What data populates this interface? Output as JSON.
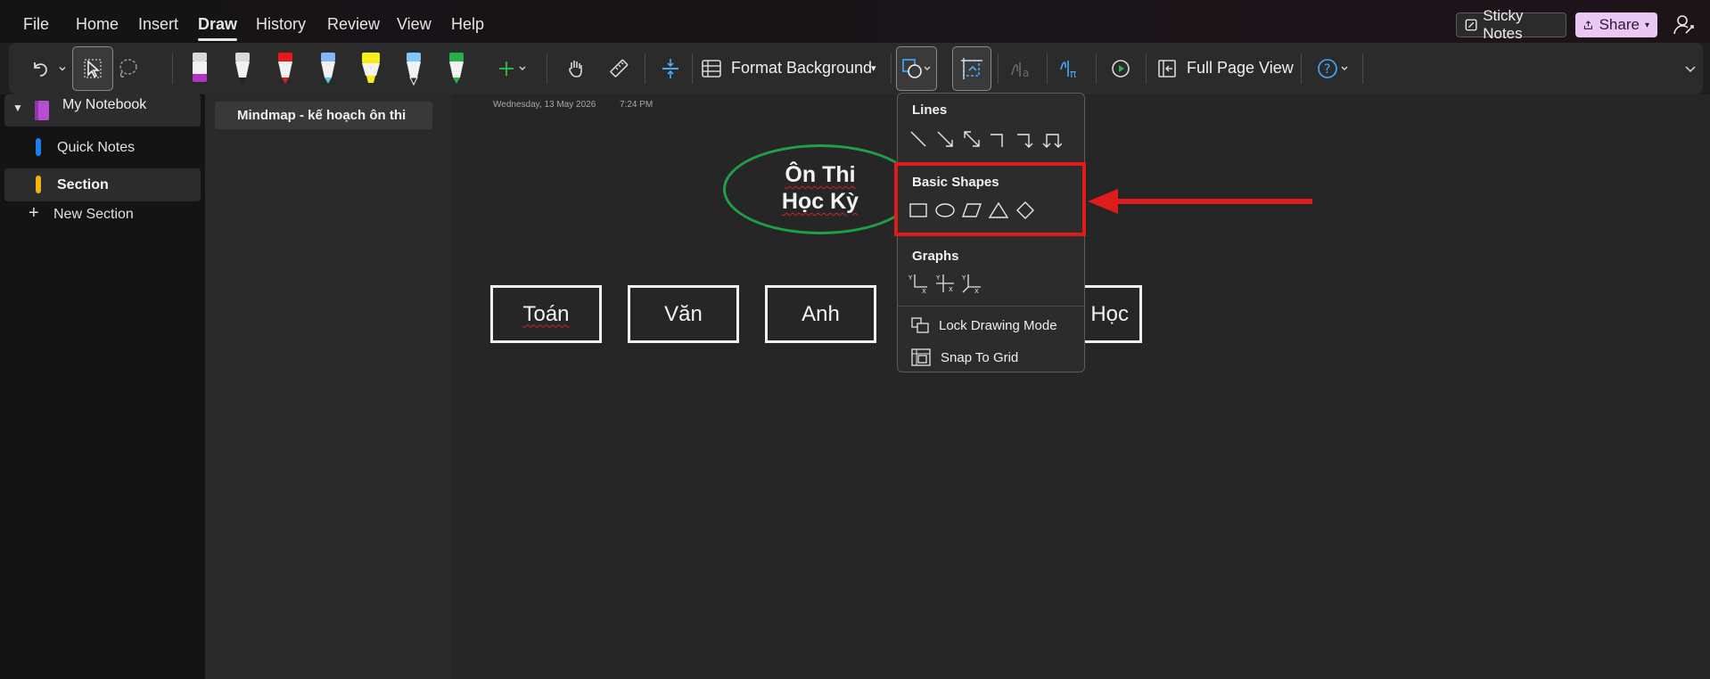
{
  "menu": {
    "items": [
      "File",
      "Home",
      "Insert",
      "Draw",
      "History",
      "Review",
      "View",
      "Help"
    ],
    "active": "Draw",
    "sticky_notes": "Sticky Notes",
    "share": "Share"
  },
  "ribbon": {
    "format_background": "Format Background",
    "full_page_view": "Full Page View"
  },
  "nav": {
    "notebook": "My Notebook",
    "sections": [
      {
        "label": "Quick Notes",
        "color": "#1e7ef0"
      },
      {
        "label": "Section",
        "color": "#f2b30a"
      }
    ],
    "new_section": "New Section"
  },
  "pages": {
    "items": [
      "Mindmap - kế hoạch ôn thi"
    ]
  },
  "note": {
    "date": "Wednesday, 13 May 2026",
    "time": "7:24 PM",
    "title_line1": "Ôn Thi",
    "title_line2": "Học Kỳ",
    "boxes": [
      "Toán",
      "Văn",
      "Anh",
      "á Học"
    ]
  },
  "shapes_menu": {
    "lines_header": "Lines",
    "basic_shapes_header": "Basic Shapes",
    "graphs_header": "Graphs",
    "lock_drawing_mode": "Lock Drawing Mode",
    "snap_to_grid": "Snap To Grid"
  },
  "colors": {
    "annotation_red": "#e01b1b",
    "oval_green": "#1fa046",
    "share_bg": "#e9c8f5"
  }
}
